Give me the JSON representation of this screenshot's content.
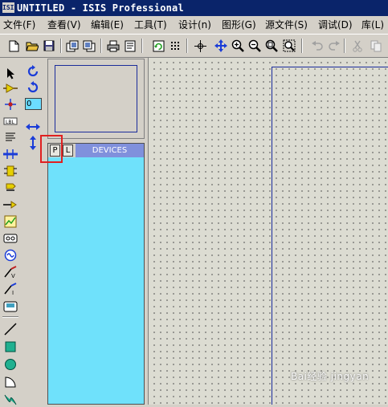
{
  "window": {
    "app_icon": "ISIS",
    "title": "UNTITLED - ISIS Professional"
  },
  "menu": {
    "items": [
      {
        "label": "文件(F)"
      },
      {
        "label": "查看(V)"
      },
      {
        "label": "编辑(E)"
      },
      {
        "label": "工具(T)"
      },
      {
        "label": "设计(n)"
      },
      {
        "label": "图形(G)"
      },
      {
        "label": "源文件(S)"
      },
      {
        "label": "调试(D)"
      },
      {
        "label": "库(L)"
      }
    ]
  },
  "toolbar": {
    "icons": [
      "new-file-icon",
      "open-folder-icon",
      "save-icon",
      "import-icon",
      "export-icon",
      "print-icon",
      "print-area-icon",
      "refresh-icon",
      "grid-icon",
      "origin-icon",
      "pan-icon",
      "zoom-in-icon",
      "zoom-out-icon",
      "zoom-all-icon",
      "zoom-area-icon",
      "undo-icon",
      "redo-icon",
      "cut-icon",
      "copy-icon"
    ]
  },
  "left_tools": {
    "icons": [
      "selection-mode-icon",
      "component-mode-icon",
      "junction-dot-icon",
      "wire-label-icon",
      "text-script-icon",
      "bus-icon",
      "subcircuit-icon",
      "terminals-icon",
      "device-pins-icon",
      "graph-mode-icon",
      "tape-recorder-icon",
      "generator-icon",
      "voltage-probe-icon",
      "current-probe-icon",
      "virtual-instruments-icon",
      "line-icon",
      "box-icon",
      "circle-icon",
      "arc-icon",
      "path-icon"
    ]
  },
  "orientation": {
    "angle_value": "0"
  },
  "selector": {
    "p_button": "P",
    "l_button": "L",
    "devices_label": "DEVICES"
  },
  "watermark": {
    "text": "Bai经验 jingyan"
  },
  "colors": {
    "titlebar": "#0a246a",
    "selector_bg": "#6fe1fb",
    "devices_header": "#8090dc",
    "canvas_bg": "#dcdcd2",
    "sheet_border": "#1b2c9a",
    "highlight": "#e02020"
  }
}
